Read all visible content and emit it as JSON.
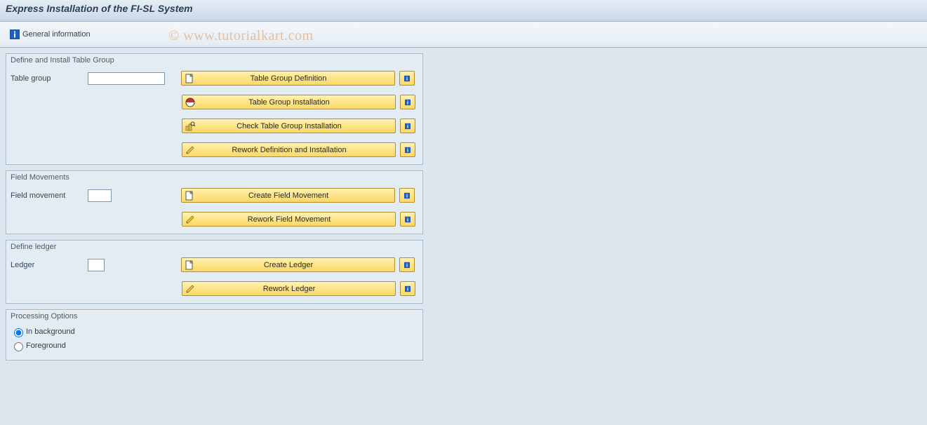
{
  "title": "Express Installation of the FI-SL System",
  "toolbar": {
    "general_info": "General information"
  },
  "watermark": "© www.tutorialkart.com",
  "groups": {
    "table_group": {
      "title": "Define and Install Table Group",
      "field_label": "Table group",
      "field_value": "",
      "buttons": {
        "definition": "Table Group Definition",
        "installation": "Table Group Installation",
        "check": "Check Table Group Installation",
        "rework": "Rework Definition and Installation"
      }
    },
    "field_movements": {
      "title": "Field Movements",
      "field_label": "Field movement",
      "field_value": "",
      "buttons": {
        "create": "Create Field Movement",
        "rework": "Rework Field Movement"
      }
    },
    "define_ledger": {
      "title": "Define ledger",
      "field_label": "Ledger",
      "field_value": "",
      "buttons": {
        "create": "Create Ledger",
        "rework": "Rework Ledger"
      }
    },
    "processing": {
      "title": "Processing Options",
      "options": {
        "background": "In background",
        "foreground": "Foreground"
      },
      "selected": "background"
    }
  }
}
